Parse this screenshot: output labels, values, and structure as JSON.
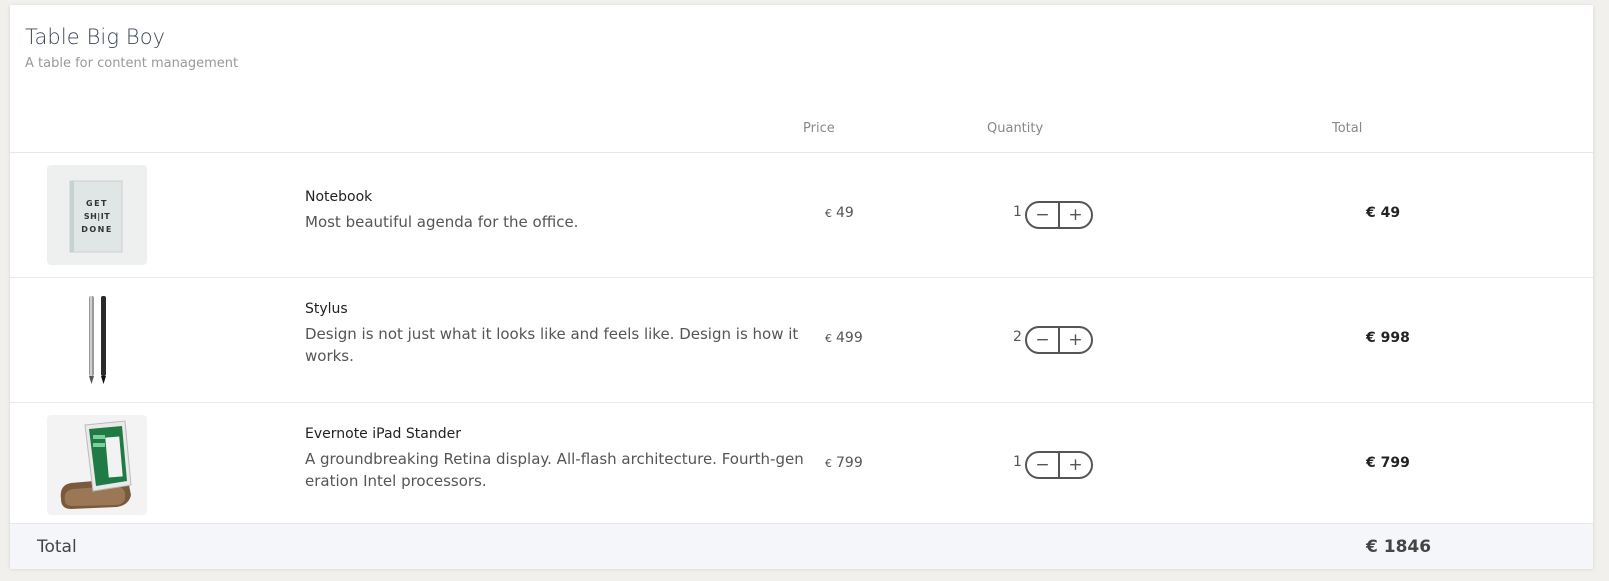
{
  "header": {
    "title": "Table Big Boy",
    "subtitle": "A table for content management"
  },
  "columns": {
    "price": "Price",
    "quantity": "Quantity",
    "total": "Total"
  },
  "rows": [
    {
      "name": "Notebook",
      "description": "Most beautiful agenda for the office.",
      "currency": "€",
      "price": "49",
      "quantity": "1",
      "total": "€ 49",
      "image_icon": "notebook-image",
      "image_text": [
        "GET",
        "SH|IT",
        "DONE"
      ]
    },
    {
      "name": "Stylus",
      "description": "Design is not just what it looks like and feels like. Design is how it works.",
      "currency": "€",
      "price": "499",
      "quantity": "2",
      "total": "€ 998",
      "image_icon": "stylus-image"
    },
    {
      "name": "Evernote iPad Stander",
      "description": "A groundbreaking Retina display. All-flash architecture. Fourth-generation Intel processors.",
      "currency": "€",
      "price": "799",
      "quantity": "1",
      "total": "€ 799",
      "image_icon": "ipad-stand-image"
    }
  ],
  "stepper": {
    "minus": "−",
    "plus": "+"
  },
  "footer": {
    "label": "Total",
    "total": "€ 1846"
  }
}
